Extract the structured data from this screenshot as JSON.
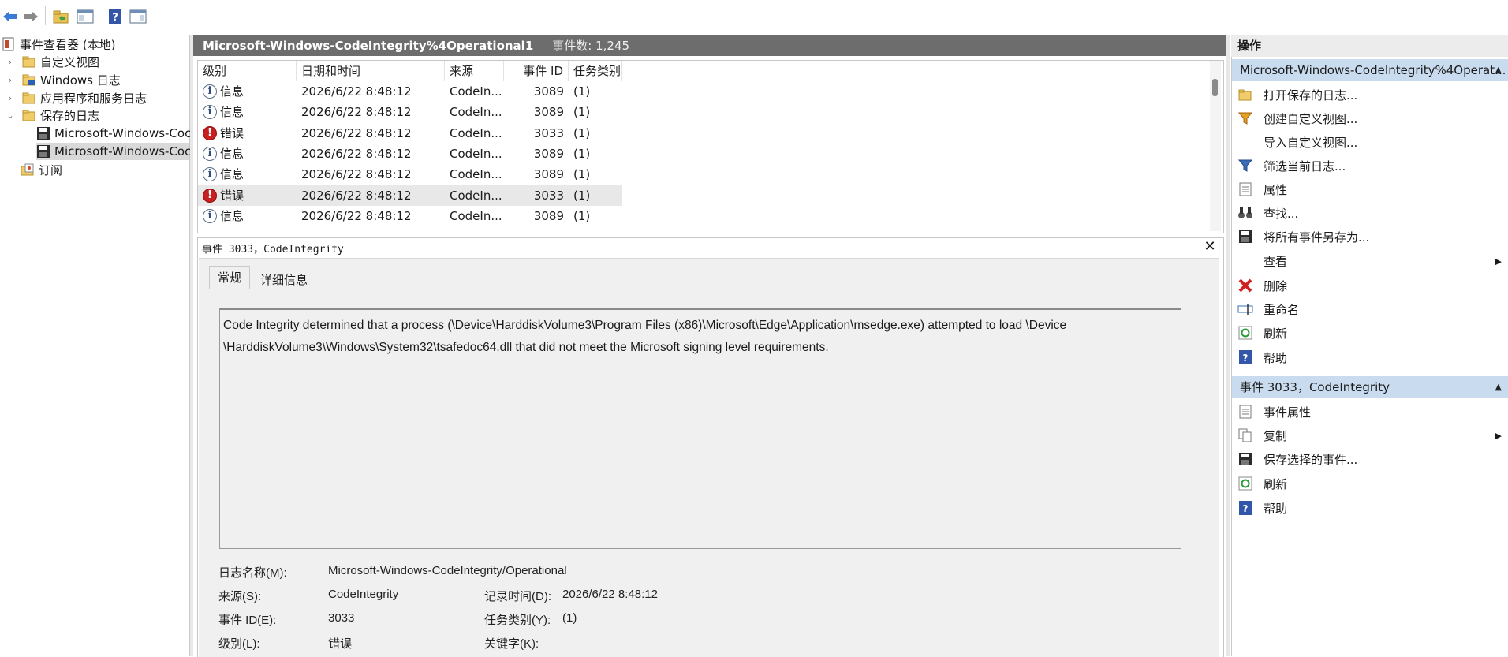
{
  "tree": {
    "root": "事件查看器 (本地)",
    "custom_views": "自定义视图",
    "windows_logs": "Windows 日志",
    "app_service_logs": "应用程序和服务日志",
    "saved_logs": "保存的日志",
    "saved_log_1": "Microsoft-Windows-Coc",
    "saved_log_2": "Microsoft-Windows-Coc",
    "subscriptions": "订阅"
  },
  "log_header": {
    "title": "Microsoft-Windows-CodeIntegrity%4Operational1",
    "count": "事件数: 1,245"
  },
  "grid": {
    "columns": [
      "级别",
      "日期和时间",
      "来源",
      "事件 ID",
      "任务类别"
    ],
    "rows": [
      {
        "level": "信息",
        "type": "info",
        "datetime": "2026/6/22 8:48:12",
        "source": "CodeIn...",
        "event_id": "3089",
        "task": "(1)"
      },
      {
        "level": "信息",
        "type": "info",
        "datetime": "2026/6/22 8:48:12",
        "source": "CodeIn...",
        "event_id": "3089",
        "task": "(1)"
      },
      {
        "level": "错误",
        "type": "error",
        "datetime": "2026/6/22 8:48:12",
        "source": "CodeIn...",
        "event_id": "3033",
        "task": "(1)"
      },
      {
        "level": "信息",
        "type": "info",
        "datetime": "2026/6/22 8:48:12",
        "source": "CodeIn...",
        "event_id": "3089",
        "task": "(1)"
      },
      {
        "level": "信息",
        "type": "info",
        "datetime": "2026/6/22 8:48:12",
        "source": "CodeIn...",
        "event_id": "3089",
        "task": "(1)"
      },
      {
        "level": "错误",
        "type": "error",
        "datetime": "2026/6/22 8:48:12",
        "source": "CodeIn...",
        "event_id": "3033",
        "task": "(1)"
      },
      {
        "level": "信息",
        "type": "info",
        "datetime": "2026/6/22 8:48:12",
        "source": "CodeIn...",
        "event_id": "3089",
        "task": "(1)"
      }
    ]
  },
  "detail": {
    "title": "事件 3033，CodeIntegrity",
    "tab_general": "常规",
    "tab_details": "详细信息",
    "description_line1": "Code Integrity determined that a process (\\Device\\HarddiskVolume3\\Program Files (x86)\\Microsoft\\Edge\\Application\\msedge.exe) attempted to load \\Device",
    "description_line2": "\\HarddiskVolume3\\Windows\\System32\\tsafedoc64.dll that did not meet the Microsoft signing level requirements.",
    "log_name_label": "日志名称(M):",
    "log_name_value": "Microsoft-Windows-CodeIntegrity/Operational",
    "source_label": "来源(S):",
    "source_value": "CodeIntegrity",
    "logged_label": "记录时间(D):",
    "logged_value": "2026/6/22 8:48:12",
    "event_id_label": "事件 ID(E):",
    "event_id_value": "3033",
    "task_label": "任务类别(Y):",
    "task_value": "(1)",
    "level_label": "级别(L):",
    "level_value": "错误",
    "keywords_label": "关键字(K):"
  },
  "actions": {
    "title": "操作",
    "section1": "Microsoft-Windows-CodeIntegrity%4Operat...",
    "items1": [
      "打开保存的日志...",
      "创建自定义视图...",
      "导入自定义视图...",
      "筛选当前日志...",
      "属性",
      "查找...",
      "将所有事件另存为...",
      "查看",
      "删除",
      "重命名",
      "刷新",
      "帮助"
    ],
    "section2": "事件 3033，CodeIntegrity",
    "items2": [
      "事件属性",
      "复制",
      "保存选择的事件...",
      "刷新",
      "帮助"
    ]
  },
  "colors": {
    "header_bg": "#6d6d6d",
    "section_bg": "#c9dcef",
    "error_icon": "#c82020",
    "selected_row": "#e8e8e8"
  }
}
